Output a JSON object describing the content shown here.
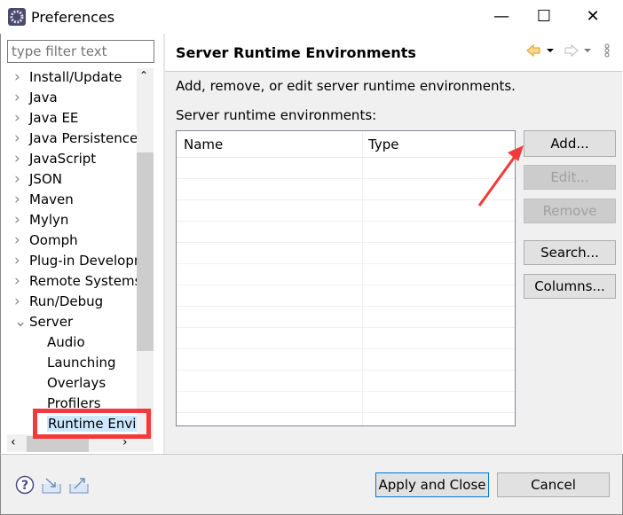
{
  "window": {
    "title": "Preferences",
    "minimize": "—",
    "maximize": "☐",
    "close": "✕"
  },
  "filter": {
    "placeholder": "type filter text"
  },
  "tree": [
    {
      "label": "Install/Update",
      "level": 0
    },
    {
      "label": "Java",
      "level": 0
    },
    {
      "label": "Java EE",
      "level": 0
    },
    {
      "label": "Java Persistence",
      "level": 0
    },
    {
      "label": "JavaScript",
      "level": 0
    },
    {
      "label": "JSON",
      "level": 0
    },
    {
      "label": "Maven",
      "level": 0
    },
    {
      "label": "Mylyn",
      "level": 0
    },
    {
      "label": "Oomph",
      "level": 0
    },
    {
      "label": "Plug-in Developr",
      "level": 0
    },
    {
      "label": "Remote Systems",
      "level": 0
    },
    {
      "label": "Run/Debug",
      "level": 0
    },
    {
      "label": "Server",
      "level": 0,
      "expanded": true
    },
    {
      "label": "Audio",
      "level": 1
    },
    {
      "label": "Launching",
      "level": 1
    },
    {
      "label": "Overlays",
      "level": 1
    },
    {
      "label": "Profilers",
      "level": 1
    },
    {
      "label": "Runtime Envir",
      "level": 1,
      "selected": true
    }
  ],
  "page": {
    "title": "Server Runtime Environments",
    "description": "Add, remove, or edit server runtime environments.",
    "list_label": "Server runtime environments:"
  },
  "table": {
    "columns": [
      "Name",
      "Type"
    ],
    "rows": []
  },
  "buttons": {
    "add": "Add...",
    "edit": "Edit...",
    "remove": "Remove",
    "search": "Search...",
    "columns": "Columns..."
  },
  "footer": {
    "apply_close": "Apply and Close",
    "cancel": "Cancel"
  },
  "colors": {
    "annotation": "#f23a3a",
    "selection": "#cce8ff"
  }
}
